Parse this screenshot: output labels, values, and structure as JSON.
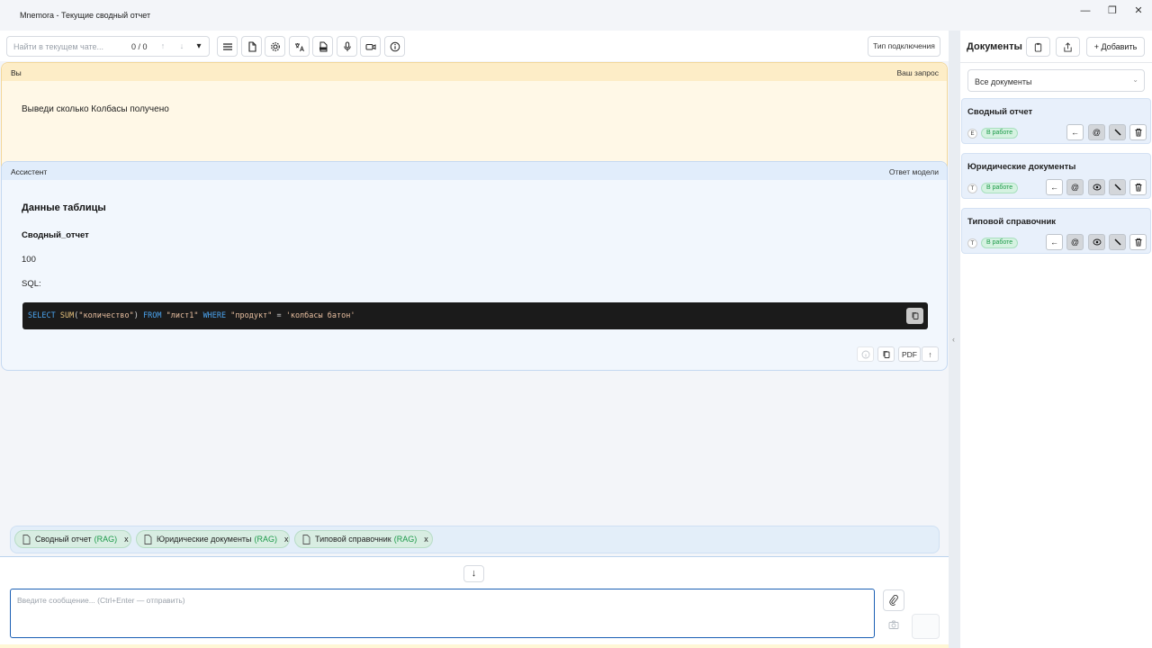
{
  "window": {
    "title": "Mnemora - Текущие сводный отчет",
    "minimize": "—",
    "restore": "❐",
    "close": "✕"
  },
  "toolbar": {
    "search_placeholder": "Найти в текущем чате...",
    "search_count": "0 / 0",
    "prev": "↑",
    "next": "↓",
    "dropdown": "▾",
    "connection_type": "Тип подключения"
  },
  "user_message": {
    "author": "Вы",
    "kind": "Ваш запрос",
    "text": "Выведи сколько Колбасы получено"
  },
  "assistant_message": {
    "author": "Ассистент",
    "kind": "Ответ модели",
    "heading": "Данные таблицы",
    "subheading": "Сводный_отчет",
    "value": "100",
    "sql_label": "SQL:",
    "code": {
      "t1": "SELECT",
      "t2": " ",
      "t3": "SUM",
      "t4": "(",
      "t5": "\"количество\"",
      "t6": ") ",
      "t7": "FROM",
      "t8": " ",
      "t9": "\"лист1\"",
      "t10": " ",
      "t11": "WHERE",
      "t12": " ",
      "t13": "\"продукт\"",
      "t14": " = ",
      "t15": "'колбасы батон'"
    },
    "pdf_label": "PDF",
    "up_label": "↑"
  },
  "context_tags": [
    {
      "name": "Сводный отчет",
      "suffix": "(RAG)",
      "close": "x"
    },
    {
      "name": "Юридические документы",
      "suffix": "(RAG)",
      "close": "x"
    },
    {
      "name": "Типовой справочник",
      "suffix": "(RAG)",
      "close": "x"
    }
  ],
  "composer": {
    "scroll_down": "↓",
    "placeholder": "Введите сообщение... (Ctrl+Enter — отправить)"
  },
  "sidebar": {
    "title": "Документы",
    "add_label": "+ Добавить",
    "filter_value": "Все документы",
    "documents": [
      {
        "name": "Сводный отчет",
        "letter": "E",
        "status": "В работе"
      },
      {
        "name": "Юридические документы",
        "letter": "T",
        "status": "В работе"
      },
      {
        "name": "Типовой справочник",
        "letter": "T",
        "status": "В работе"
      }
    ],
    "collapse": "‹"
  },
  "colors": {
    "accent": "#1a5fb4",
    "status_green": "#1d9a4a",
    "user_bg": "#fff8e7",
    "assistant_bg": "#f2f7fd"
  }
}
